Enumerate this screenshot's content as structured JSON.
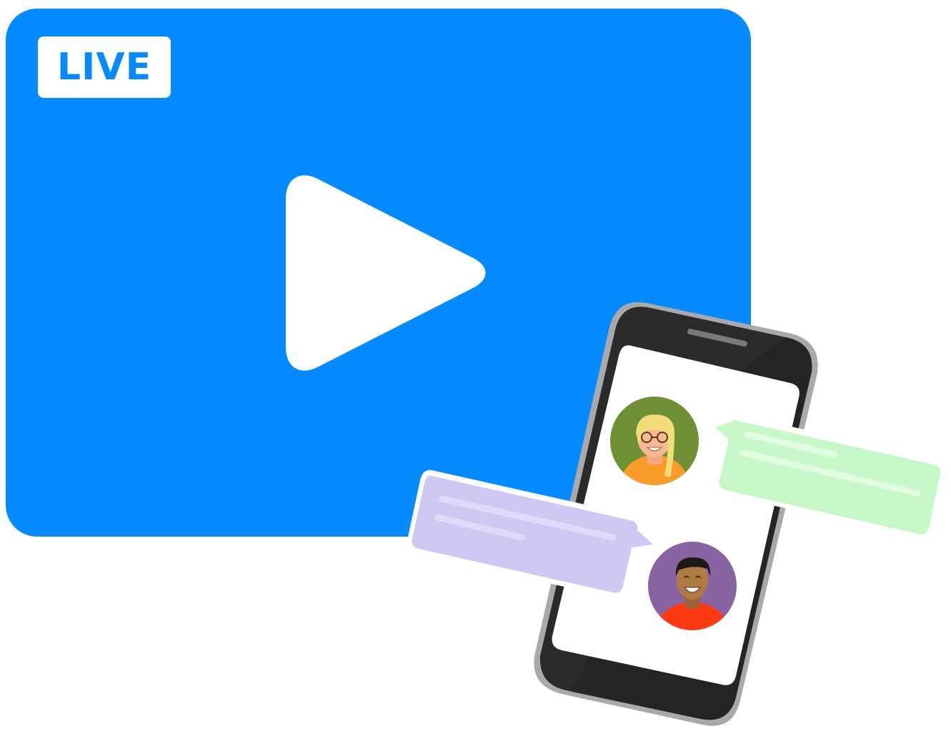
{
  "live_badge": {
    "label": "LIVE"
  },
  "colors": {
    "video_blue": "#058aff",
    "badge_text": "#058aff",
    "phone_body": "#2b2929",
    "phone_edge": "#a7a9ac",
    "screen": "#ffffff",
    "bubble_green": "#c7f8c9",
    "bubble_purple": "#cfc8f3",
    "avatar_green": "#6f8f34",
    "avatar_purple": "#8964a3",
    "shirt_orange": "#fb9b2a",
    "shirt_red": "#fd3a12"
  },
  "icons": {
    "play": "play-icon",
    "phone": "smartphone-icon",
    "avatar_woman": "woman-avatar-icon",
    "avatar_man": "man-avatar-icon",
    "chat": "chat-bubble-icon"
  }
}
